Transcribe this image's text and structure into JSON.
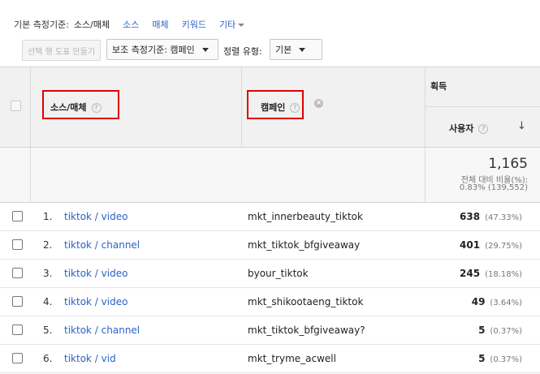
{
  "dimension_bar": {
    "label": "기본 측정기준:",
    "active": "소스/매체",
    "links": [
      "소스",
      "매체",
      "키워드",
      "기타"
    ]
  },
  "toolbar": {
    "create_pivot": "선택 행 도표 만들기",
    "secondary_dimension": "보조 측정기준: 캠페인",
    "sort_type_label": "정렬 유형:",
    "sort_type_value": "기본"
  },
  "table": {
    "columns": {
      "source_medium": "소스/매체",
      "campaign": "캠페인",
      "acquisition": "획득",
      "users": "사용자"
    },
    "totals": {
      "value": "1,165",
      "sub1": "전체 대비 비율(%):",
      "sub2": "0.83% (139,552)"
    },
    "rows": [
      {
        "num": "1.",
        "source": "tiktok / video",
        "campaign": "mkt_innerbeauty_tiktok",
        "users": "638",
        "pct": "(47.33%)"
      },
      {
        "num": "2.",
        "source": "tiktok / channel",
        "campaign": "mkt_tiktok_bfgiveaway",
        "users": "401",
        "pct": "(29.75%)"
      },
      {
        "num": "3.",
        "source": "tiktok / video",
        "campaign": "byour_tiktok",
        "users": "245",
        "pct": "(18.18%)"
      },
      {
        "num": "4.",
        "source": "tiktok / video",
        "campaign": "mkt_shikootaeng_tiktok",
        "users": "49",
        "pct": "(3.64%)"
      },
      {
        "num": "5.",
        "source": "tiktok / channel",
        "campaign": "mkt_tiktok_bfgiveaway?",
        "users": "5",
        "pct": "(0.37%)"
      },
      {
        "num": "6.",
        "source": "tiktok / vid",
        "campaign": "mkt_tryme_acwell",
        "users": "5",
        "pct": "(0.37%)"
      }
    ]
  },
  "colors": {
    "link": "#2a62c8",
    "highlight": "#e00000",
    "header_bg": "#f1f1f1"
  },
  "icons": [
    "help-icon",
    "remove-dimension-icon",
    "sort-down-arrow-icon",
    "dropdown-caret-icon"
  ]
}
